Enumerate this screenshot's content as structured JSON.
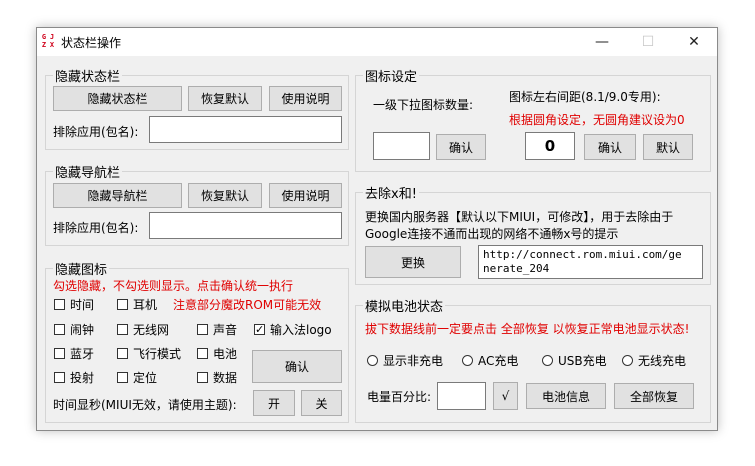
{
  "window": {
    "title": "状态栏操作",
    "icon_letters": [
      "G",
      "J",
      "Z",
      "X"
    ],
    "minimize_icon": "—",
    "maximize_icon": "☐",
    "close_icon": "✕"
  },
  "hide_statusbar": {
    "legend": "隐藏状态栏",
    "hide_button": "隐藏状态栏",
    "restore_button": "恢复默认",
    "help_button": "使用说明",
    "exclude_label": "排除应用(包名):",
    "exclude_value": ""
  },
  "hide_navbar": {
    "legend": "隐藏导航栏",
    "hide_button": "隐藏导航栏",
    "restore_button": "恢复默认",
    "help_button": "使用说明",
    "exclude_label": "排除应用(包名):",
    "exclude_value": ""
  },
  "hide_icons": {
    "legend": "隐藏图标",
    "hint": "勾选隐藏，不勾选则显示。点击确认统一执行",
    "warning": "注意部分魔改ROM可能无效",
    "items": {
      "time": {
        "label": "时间",
        "checked": false
      },
      "headphone": {
        "label": "耳机",
        "checked": false
      },
      "alarm": {
        "label": "闹钟",
        "checked": false
      },
      "wifi": {
        "label": "无线网",
        "checked": false
      },
      "sound": {
        "label": "声音",
        "checked": false
      },
      "ime_logo": {
        "label": "输入法logo",
        "checked": true
      },
      "bluetooth": {
        "label": "蓝牙",
        "checked": false
      },
      "airplane": {
        "label": "飞行模式",
        "checked": false
      },
      "battery": {
        "label": "电池",
        "checked": false
      },
      "cast": {
        "label": "投射",
        "checked": false
      },
      "location": {
        "label": "定位",
        "checked": false
      },
      "data": {
        "label": "数据",
        "checked": false
      }
    },
    "confirm_button": "确认",
    "seconds_label": "时间显秒(MIUI无效，请使用主题):",
    "on_button": "开",
    "off_button": "关"
  },
  "icon_settings": {
    "legend": "图标设定",
    "dropdown_label": "一级下拉图标数量:",
    "dropdown_value": "",
    "dropdown_confirm": "确认",
    "spacing_label": "图标左右间距(8.1/9.0专用):",
    "spacing_hint": "根据圆角设定，无圆角建议设为0",
    "spacing_value": "0",
    "spacing_confirm": "确认",
    "spacing_default": "默认"
  },
  "remove_x": {
    "legend": "去除x和!",
    "description_line1": "更换国内服务器【默认以下MIUI，可修改】，用于去除由于",
    "description_line2": "Google连接不通而出现的网络不通畅x号的提示",
    "replace_button": "更换",
    "url_line1": "http://connect.rom.miui.com/ge",
    "url_line2": "nerate_204"
  },
  "battery_sim": {
    "legend": "模拟电池状态",
    "warning": "拔下数据线前一定要点击 全部恢复 以恢复正常电池显示状态!",
    "radios": {
      "not_charging": "显示非充电",
      "ac": "AC充电",
      "usb": "USB充电",
      "wireless": "无线充电"
    },
    "level_label": "电量百分比:",
    "level_value": "",
    "apply_button": "√",
    "info_button": "电池信息",
    "restore_all_button": "全部恢复"
  }
}
